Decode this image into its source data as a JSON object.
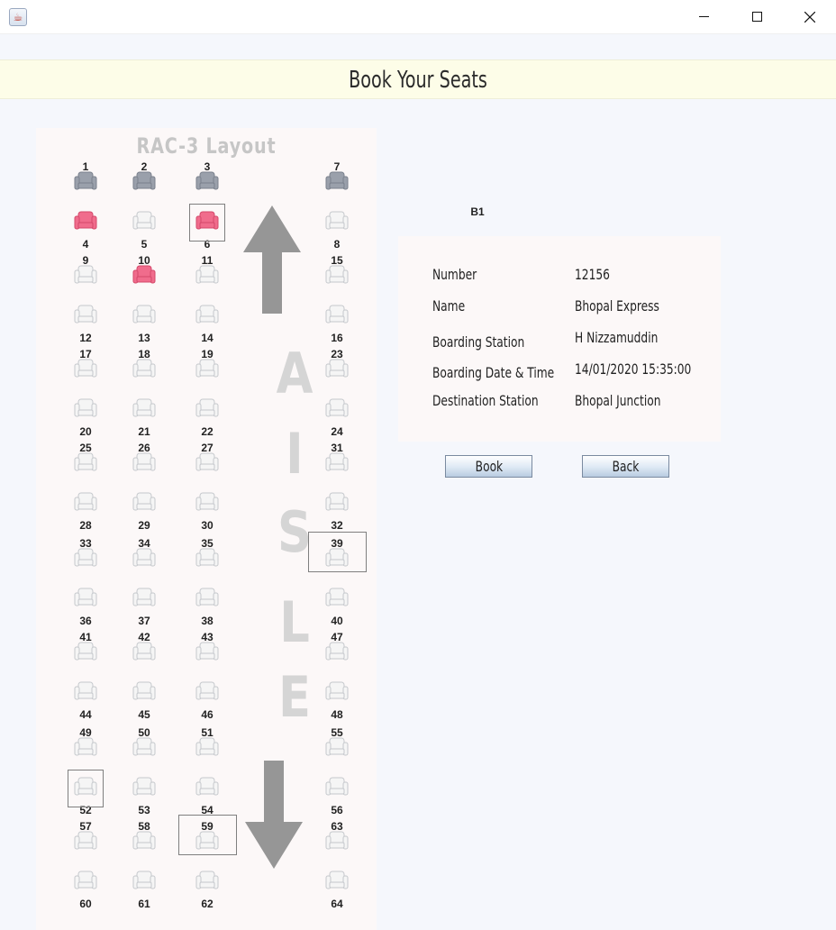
{
  "window": {
    "title": "",
    "icon": "java-cup-icon",
    "controls": [
      "minimize",
      "maximize",
      "close"
    ]
  },
  "header": {
    "title": "Book Your Seats"
  },
  "layout": {
    "title": "RAC-3 Layout",
    "aisle_letters": [
      "A",
      "I",
      "S",
      "L",
      "E"
    ],
    "seats": [
      {
        "n": "1",
        "state": "booked"
      },
      {
        "n": "2",
        "state": "booked"
      },
      {
        "n": "3",
        "state": "booked"
      },
      {
        "n": "7",
        "state": "booked"
      },
      {
        "n": "4",
        "state": "selected"
      },
      {
        "n": "5",
        "state": "available"
      },
      {
        "n": "6",
        "state": "selected"
      },
      {
        "n": "8",
        "state": "available"
      },
      {
        "n": "9",
        "state": "available"
      },
      {
        "n": "10",
        "state": "selected"
      },
      {
        "n": "11",
        "state": "available"
      },
      {
        "n": "15",
        "state": "available"
      },
      {
        "n": "12",
        "state": "available"
      },
      {
        "n": "13",
        "state": "available"
      },
      {
        "n": "14",
        "state": "available"
      },
      {
        "n": "16",
        "state": "available"
      },
      {
        "n": "17",
        "state": "available"
      },
      {
        "n": "18",
        "state": "available"
      },
      {
        "n": "19",
        "state": "available"
      },
      {
        "n": "23",
        "state": "available"
      },
      {
        "n": "20",
        "state": "available"
      },
      {
        "n": "21",
        "state": "available"
      },
      {
        "n": "22",
        "state": "available"
      },
      {
        "n": "24",
        "state": "available"
      },
      {
        "n": "25",
        "state": "available"
      },
      {
        "n": "26",
        "state": "available"
      },
      {
        "n": "27",
        "state": "available"
      },
      {
        "n": "31",
        "state": "available"
      },
      {
        "n": "28",
        "state": "available"
      },
      {
        "n": "29",
        "state": "available"
      },
      {
        "n": "30",
        "state": "available"
      },
      {
        "n": "32",
        "state": "available"
      },
      {
        "n": "33",
        "state": "available"
      },
      {
        "n": "34",
        "state": "available"
      },
      {
        "n": "35",
        "state": "available"
      },
      {
        "n": "39",
        "state": "available"
      },
      {
        "n": "36",
        "state": "available"
      },
      {
        "n": "37",
        "state": "available"
      },
      {
        "n": "38",
        "state": "available"
      },
      {
        "n": "40",
        "state": "available"
      },
      {
        "n": "41",
        "state": "available"
      },
      {
        "n": "42",
        "state": "available"
      },
      {
        "n": "43",
        "state": "available"
      },
      {
        "n": "47",
        "state": "available"
      },
      {
        "n": "44",
        "state": "available"
      },
      {
        "n": "45",
        "state": "available"
      },
      {
        "n": "46",
        "state": "available"
      },
      {
        "n": "48",
        "state": "available"
      },
      {
        "n": "49",
        "state": "available"
      },
      {
        "n": "50",
        "state": "available"
      },
      {
        "n": "51",
        "state": "available"
      },
      {
        "n": "55",
        "state": "available"
      },
      {
        "n": "52",
        "state": "available"
      },
      {
        "n": "53",
        "state": "available"
      },
      {
        "n": "54",
        "state": "available"
      },
      {
        "n": "56",
        "state": "available"
      },
      {
        "n": "57",
        "state": "available"
      },
      {
        "n": "58",
        "state": "available"
      },
      {
        "n": "59",
        "state": "available"
      },
      {
        "n": "63",
        "state": "available"
      },
      {
        "n": "60",
        "state": "available"
      },
      {
        "n": "61",
        "state": "available"
      },
      {
        "n": "62",
        "state": "available"
      },
      {
        "n": "64",
        "state": "available"
      }
    ],
    "focused_seats": [
      "6",
      "39",
      "52",
      "59"
    ]
  },
  "coach": "B1",
  "train": {
    "labels": {
      "number": "Number",
      "name": "Name",
      "boarding_station": "Boarding Station",
      "boarding_datetime": "Boarding Date & Time",
      "destination_station": "Destination Station"
    },
    "number": "12156",
    "name": "Bhopal Express",
    "boarding_station": "H Nizzamuddin",
    "boarding_datetime": "14/01/2020 15:35:00",
    "destination_station": "Bhopal Junction"
  },
  "actions": {
    "book": "Book",
    "back": "Back"
  },
  "colors": {
    "booked_seat": "#9aa0ab",
    "selected_seat": "#f06c8c",
    "available_seat": "#f5f5f5",
    "aisle": "#d5d5d5",
    "arrow": "#969696"
  }
}
